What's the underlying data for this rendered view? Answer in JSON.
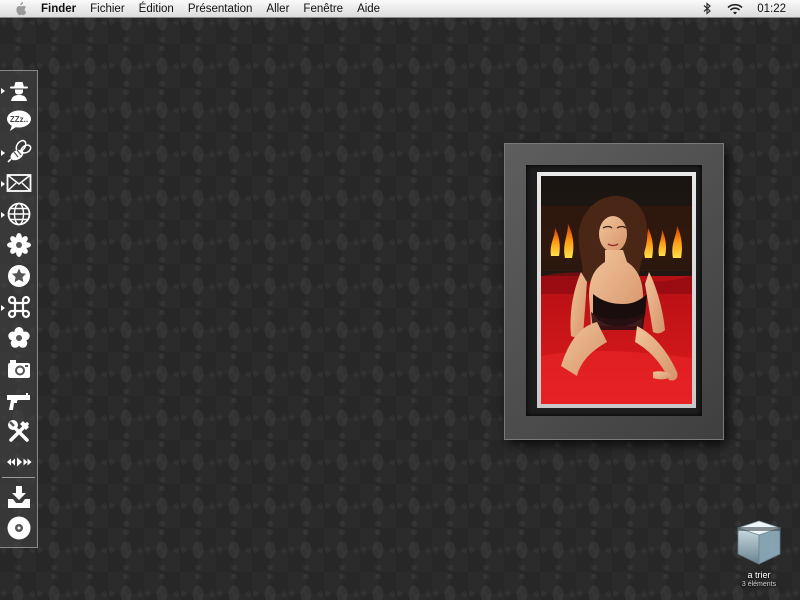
{
  "menubar": {
    "apple_icon": "apple-icon",
    "items": [
      "Finder",
      "Fichier",
      "Édition",
      "Présentation",
      "Aller",
      "Fenêtre",
      "Aide"
    ],
    "status_icons": [
      "bluetooth-icon",
      "wifi-icon"
    ],
    "clock": "01:22"
  },
  "dock": {
    "items": [
      {
        "icon": "spy-agent-icon",
        "running": true
      },
      {
        "icon": "speech-bubble-zzz-icon",
        "running": false
      },
      {
        "icon": "bee-icon",
        "running": true
      },
      {
        "icon": "envelope-icon",
        "running": true
      },
      {
        "icon": "globe-icon",
        "running": true
      },
      {
        "icon": "flower-gear-icon",
        "running": false
      },
      {
        "icon": "star-circle-icon",
        "running": false
      },
      {
        "icon": "command-key-icon",
        "running": true
      },
      {
        "icon": "flower-icon",
        "running": false
      },
      {
        "icon": "camera-icon",
        "running": false
      },
      {
        "icon": "pistol-icon",
        "running": false
      },
      {
        "icon": "hammer-wrench-icon",
        "running": false
      },
      {
        "icon": "media-controls-icon",
        "running": false
      }
    ],
    "stack_items": [
      {
        "icon": "download-tray-icon"
      },
      {
        "icon": "disc-icon"
      }
    ]
  },
  "widget": {
    "name": "photo-frame-widget",
    "photo_subject": "woman-by-fireplace-photo"
  },
  "desktop": {
    "folder": {
      "label": "a trier",
      "count": "3 éléments",
      "icon": "storage-box-icon"
    }
  },
  "colors": {
    "menubar_bg": "#e8e8e8",
    "desktop_bg": "#2b2b2b",
    "dock_bg": "#464646",
    "frame": "#4e4e4e",
    "photo_red": "#c8141a",
    "fire_orange": "#f29a1a"
  }
}
